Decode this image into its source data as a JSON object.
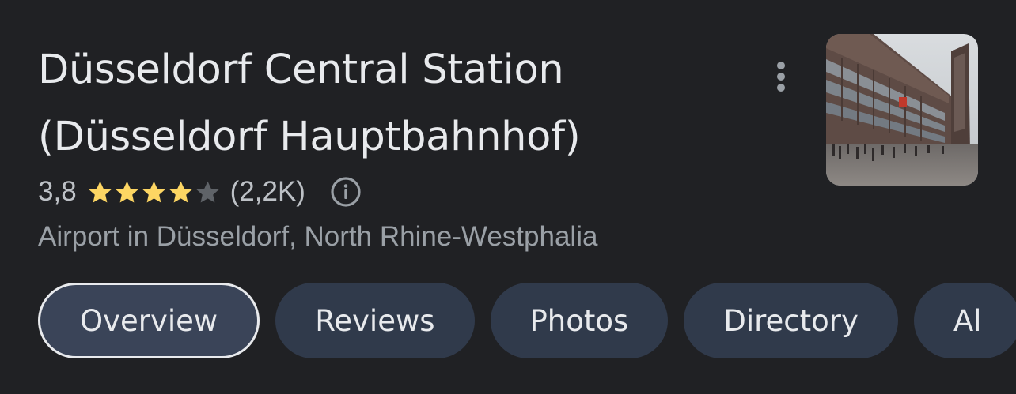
{
  "place": {
    "name_line1": "Düsseldorf Central Station",
    "name_line2": "(Düsseldorf Hauptbahnhof)",
    "rating_value": "3,8",
    "rating_stars": 3.8,
    "review_count": "(2,2K)",
    "category": "Airport in Düsseldorf, North Rhine-Westphalia"
  },
  "icons": {
    "more": "more-vert-icon",
    "info": "info-icon",
    "star": "star-icon"
  },
  "colors": {
    "background": "#202124",
    "star_filled": "#fdd663",
    "star_empty": "#5f6368",
    "chip_background": "#303a4b"
  },
  "tabs": [
    {
      "label": "Overview",
      "active": true
    },
    {
      "label": "Reviews",
      "active": false
    },
    {
      "label": "Photos",
      "active": false
    },
    {
      "label": "Directory",
      "active": false
    },
    {
      "label": "Al",
      "active": false
    }
  ]
}
